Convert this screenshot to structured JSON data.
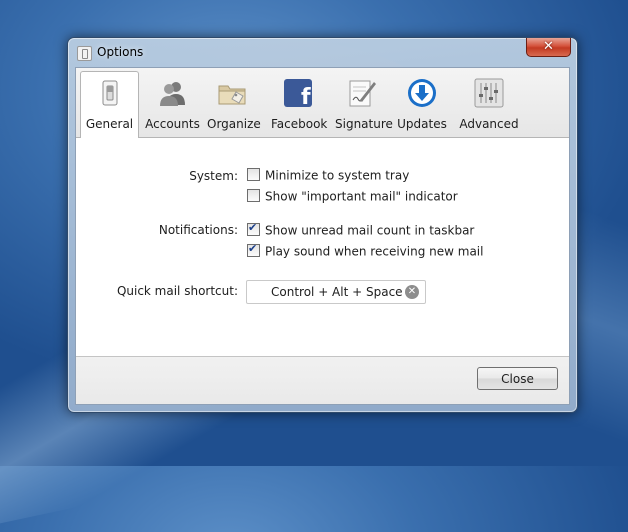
{
  "window": {
    "title": "Options"
  },
  "tabs": [
    {
      "label": "General",
      "icon": "switch-icon"
    },
    {
      "label": "Accounts",
      "icon": "accounts-icon"
    },
    {
      "label": "Organize",
      "icon": "folder-icon"
    },
    {
      "label": "Facebook",
      "icon": "facebook-icon"
    },
    {
      "label": "Signature",
      "icon": "signature-icon"
    },
    {
      "label": "Updates",
      "icon": "download-icon"
    },
    {
      "label": "Advanced",
      "icon": "sliders-icon"
    }
  ],
  "general": {
    "system": {
      "label": "System:",
      "options": [
        {
          "label": "Minimize to system tray",
          "checked": false
        },
        {
          "label": "Show \"important mail\" indicator",
          "checked": false
        }
      ]
    },
    "notifications": {
      "label": "Notifications:",
      "options": [
        {
          "label": "Show unread mail count in taskbar",
          "checked": true
        },
        {
          "label": "Play sound when receiving new mail",
          "checked": true
        }
      ]
    },
    "shortcut": {
      "label": "Quick mail shortcut:",
      "value": "Control + Alt + Space"
    }
  },
  "footer": {
    "close_label": "Close"
  },
  "colors": {
    "accent": "#1b6fc8",
    "facebook": "#3b5998",
    "selected_tab": "#ffffff"
  }
}
